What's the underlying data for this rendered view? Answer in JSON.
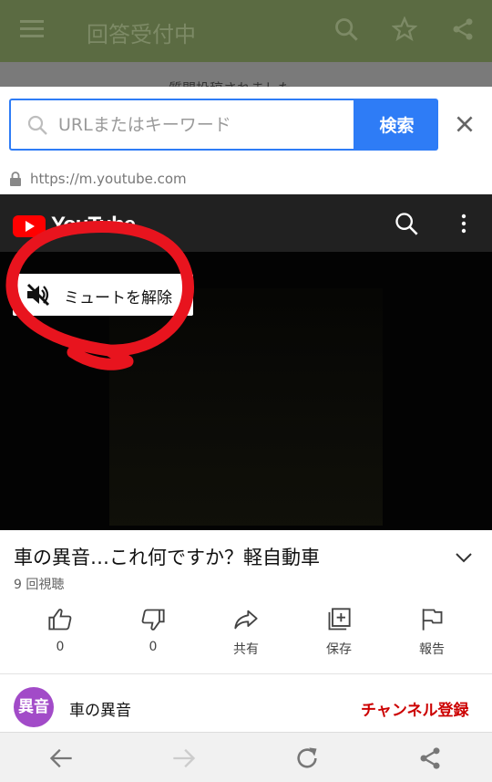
{
  "app_header": {
    "title": "回答受付中"
  },
  "behind_text": "質問投稿されました",
  "browser": {
    "search_placeholder": "URLまたはキーワード",
    "search_button": "検索",
    "url": "https://m.youtube.com"
  },
  "youtube": {
    "logo_text": "YouTube",
    "unmute_label": "ミュートを解除",
    "video_title": "車の異音…これ何ですか？軽自動車",
    "views": "9 回視聴",
    "actions": [
      {
        "label": "0",
        "icon": "thumbs-up-icon"
      },
      {
        "label": "0",
        "icon": "thumbs-down-icon"
      },
      {
        "label": "共有",
        "icon": "share-arrow-icon"
      },
      {
        "label": "保存",
        "icon": "playlist-add-icon"
      },
      {
        "label": "報告",
        "icon": "flag-icon"
      }
    ],
    "channel": {
      "avatar_text": "異音",
      "name": "車の異音",
      "subscribe_label": "チャンネル登録"
    }
  },
  "colors": {
    "accent": "#2e7cf6",
    "youtube_red": "#ff0000",
    "annotation": "#e8141e",
    "avatar": "#a24bc8"
  }
}
